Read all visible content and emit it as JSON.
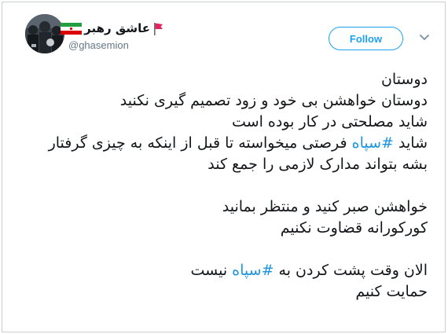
{
  "user": {
    "display_name": "عاشق رهبر",
    "handle": "@ghasemion"
  },
  "follow_button": {
    "label": "Follow"
  },
  "menu": {
    "icon": "chevron-down-icon"
  },
  "icons": [
    "iran-flag-icon",
    "red-flag-icon",
    "chevron-down-icon"
  ],
  "colors": {
    "accent": "#1da1f2",
    "hashtag": "#1b95e0",
    "text": "#14171a",
    "muted": "#657786"
  },
  "tweet": {
    "line1": "دوستان",
    "line2": "دوستان خواهشن بی خود و زود تصمیم گیری نکنید",
    "line3": "شاید مصلحتی در کار بوده است",
    "line4_before": "شاید ",
    "line4_hashtag": "#سپاه",
    "line4_after": " فرصتی میخواسته تا قبل از اینکه به چیزی گرفتار",
    "line5": "بشه بتواند مدارک لازمی را جمع کند",
    "line6": "خواهشن صبر کنید و منتظر بمانید",
    "line7": "کورکورانه قضاوت نکنیم",
    "line8_before": "الان وقت پشت کردن به ",
    "line8_hashtag": "#سپاه",
    "line8_after": " نیست",
    "line9": "حمایت کنیم"
  }
}
